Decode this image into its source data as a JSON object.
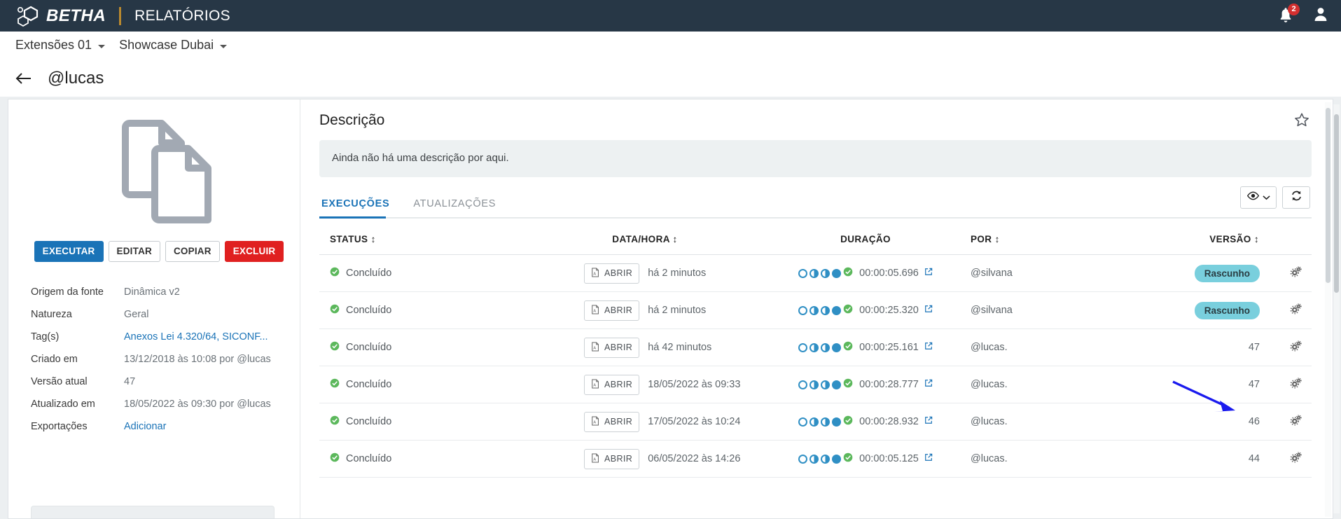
{
  "header": {
    "brand_name": "BETHA",
    "app_name": "RELATÓRIOS",
    "notification_count": "2",
    "bell_icon": "bell-icon",
    "user_icon": "user-avatar-icon",
    "brand_bar_color": "#273746",
    "accent_color": "#1a73b7"
  },
  "breadcrumb": {
    "items": [
      {
        "label": "Extensões 01"
      },
      {
        "label": "Showcase Dubai"
      }
    ]
  },
  "page": {
    "back_icon": "back-arrow-icon",
    "title": "@lucas"
  },
  "left_panel": {
    "doc_icon": "documents-icon",
    "buttons": [
      {
        "label": "EXECUTAR",
        "style": "primary"
      },
      {
        "label": "EDITAR",
        "style": "outline"
      },
      {
        "label": "COPIAR",
        "style": "outline"
      },
      {
        "label": "EXCLUIR",
        "style": "danger"
      }
    ],
    "meta": [
      {
        "key": "Origem da fonte",
        "value": "Dinâmica v2",
        "link": false
      },
      {
        "key": "Natureza",
        "value": "Geral",
        "link": false
      },
      {
        "key": "Tag(s)",
        "value": "Anexos Lei 4.320/64, SICONF...",
        "link": true
      },
      {
        "key": "Criado em",
        "value": "13/12/2018 às 10:08 por @lucas",
        "link": false
      },
      {
        "key": "Versão atual",
        "value": "47",
        "link": false
      },
      {
        "key": "Atualizado em",
        "value": "18/05/2022 às 09:30 por @lucas",
        "link": false
      },
      {
        "key": "Exportações",
        "value": "Adicionar",
        "link": true
      }
    ]
  },
  "right_panel": {
    "section_title": "Descrição",
    "description_placeholder": "Ainda não há uma descrição por aqui.",
    "star_icon": "star-outline-icon",
    "tabs": [
      {
        "label": "EXECUÇÕES",
        "active": true
      },
      {
        "label": "ATUALIZAÇÕES",
        "active": false
      }
    ],
    "tab_actions": [
      {
        "name": "visibility-dropdown",
        "icon": "eye-icon",
        "chevron": "chevron-down-icon"
      },
      {
        "name": "refresh-button",
        "icon": "refresh-icon"
      }
    ],
    "table": {
      "columns": [
        {
          "label": "STATUS",
          "sortable": true
        },
        {
          "label": "DATA/HORA",
          "sortable": true
        },
        {
          "label": "DURAÇÃO",
          "sortable": false
        },
        {
          "label": "POR",
          "sortable": true
        },
        {
          "label": "VERSÃO",
          "sortable": true
        }
      ],
      "open_button_label": "ABRIR",
      "rows": [
        {
          "status": "Concluído",
          "datahora": "há 2 minutos",
          "phases": [
            "empty",
            "half",
            "half",
            "full",
            "check"
          ],
          "duracao": "00:00:05.696",
          "por": "@silvana",
          "versao": "Rascunho",
          "versao_is_badge": true
        },
        {
          "status": "Concluído",
          "datahora": "há 2 minutos",
          "phases": [
            "empty",
            "half",
            "half",
            "full",
            "check"
          ],
          "duracao": "00:00:25.320",
          "por": "@silvana",
          "versao": "Rascunho",
          "versao_is_badge": true
        },
        {
          "status": "Concluído",
          "datahora": "há 42 minutos",
          "phases": [
            "empty",
            "half",
            "half",
            "full",
            "check"
          ],
          "duracao": "00:00:25.161",
          "por": "@lucas.",
          "versao": "47",
          "versao_is_badge": false
        },
        {
          "status": "Concluído",
          "datahora": "18/05/2022 às 09:33",
          "phases": [
            "empty",
            "half",
            "half",
            "full",
            "check"
          ],
          "duracao": "00:00:28.777",
          "por": "@lucas.",
          "versao": "47",
          "versao_is_badge": false
        },
        {
          "status": "Concluído",
          "datahora": "17/05/2022 às 10:24",
          "phases": [
            "empty",
            "half",
            "half",
            "full",
            "check"
          ],
          "duracao": "00:00:28.932",
          "por": "@lucas.",
          "versao": "46",
          "versao_is_badge": false
        },
        {
          "status": "Concluído",
          "datahora": "06/05/2022 às 14:26",
          "phases": [
            "empty",
            "half",
            "half",
            "full",
            "check"
          ],
          "duracao": "00:00:05.125",
          "por": "@lucas.",
          "versao": "44",
          "versao_is_badge": false
        }
      ]
    }
  },
  "annotation": {
    "arrow_color": "#1a1aee",
    "points_to": "Rascunho"
  },
  "colors": {
    "draft_badge": "#79cfdd",
    "status_ok": "#5cb85c",
    "phase_blue": "#2f8fc4",
    "link": "#1a73b7",
    "danger": "#e02020"
  }
}
